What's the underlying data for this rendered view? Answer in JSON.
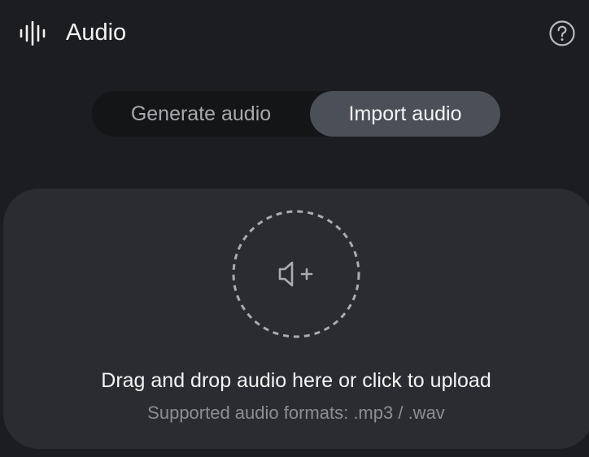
{
  "header": {
    "title": "Audio",
    "icon": "audio-waveform-icon",
    "help_icon": "help-circle-icon"
  },
  "tabs": [
    {
      "label": "Generate audio",
      "active": false
    },
    {
      "label": "Import audio",
      "active": true
    }
  ],
  "upload": {
    "icon": "speaker-add-icon",
    "title": "Drag and drop audio here or click to upload",
    "subtitle": "Supported audio formats: .mp3 / .wav"
  },
  "colors": {
    "background": "#1c1d20",
    "panel": "#2a2c31",
    "active_tab": "#4a4f58",
    "tab_track": "#141517",
    "muted_text": "#8b8e94"
  }
}
